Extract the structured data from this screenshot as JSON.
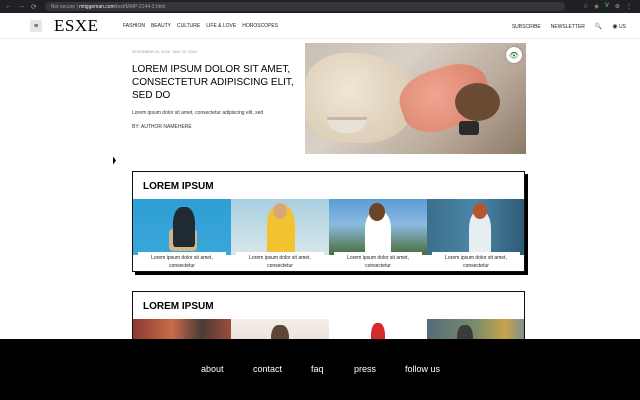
{
  "browser": {
    "nav_back": "←",
    "nav_forward": "→",
    "reload": "⟳",
    "security": "Not secure",
    "host": "mtiggeman.com",
    "path": "/test/MMP-2144-3.html",
    "extensions": [
      "☆",
      "◈",
      "V",
      "⊕",
      "⋮"
    ]
  },
  "header": {
    "menu_icon": "≡",
    "logo": "ESXE",
    "nav": [
      "FASHION",
      "BEAUTY",
      "CULTURE",
      "LIFE & LOVE",
      "HOROSCOPES"
    ],
    "subscribe": "SUBSCRIBE",
    "newsletter": "NEWSLETTER",
    "search_icon": "🔍",
    "region_icon": "◉",
    "region": "US"
  },
  "featured": {
    "meta": "NOVEMBER 20, 2018  ·  MAY 12, 2019",
    "title": "LOREM IPSUM DOLOR SIT AMET, CONSECTETUR ADIPISCING ELIT, SED DO",
    "summary": "Lorem ipsum dolor sit amet, consectetur adipiscing elit, sed",
    "author": "BY: AUTHOR NAMEHERE",
    "badge_icon": "👁"
  },
  "section1": {
    "title": "LOREM IPSUM",
    "cards": [
      {
        "caption": "Lorem ipsum dolor sit amet, consectetur"
      },
      {
        "caption": "Lorem ipsum dolor sit amet, consectetur"
      },
      {
        "caption": "Lorem ipsum dolor sit amet, consectetur"
      },
      {
        "caption": "Lorem ipsum dolor sit amet, consectetur"
      }
    ]
  },
  "section2": {
    "title": "LOREM IPSUM"
  },
  "footer": {
    "about": "about",
    "contact": "contact",
    "faq": "faq",
    "press": "press",
    "follow": "follow us"
  }
}
